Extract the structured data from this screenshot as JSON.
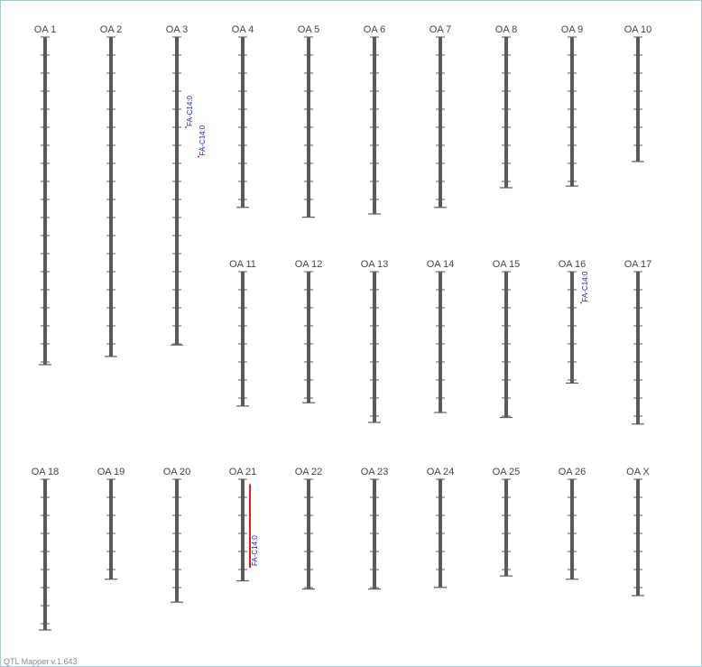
{
  "app": {
    "version_label": "QTL Mapper v.1.643"
  },
  "colors": {
    "chromosome": "#5a5a5a",
    "tick": "#5a5a5a",
    "label": "#444444",
    "qtl_text": "#1a1acc",
    "qtl_bar": "#e02020",
    "border": "#a9c6dc"
  },
  "chromosomes": [
    {
      "name": "OA 1",
      "length": 1.0
    },
    {
      "name": "OA 2",
      "length": 0.975
    },
    {
      "name": "OA 3",
      "length": 0.94
    },
    {
      "name": "OA 4",
      "length": 0.52
    },
    {
      "name": "OA 5",
      "length": 0.55
    },
    {
      "name": "OA 6",
      "length": 0.54
    },
    {
      "name": "OA 7",
      "length": 0.52
    },
    {
      "name": "OA 8",
      "length": 0.46
    },
    {
      "name": "OA 9",
      "length": 0.455
    },
    {
      "name": "OA 10",
      "length": 0.38
    },
    {
      "name": "OA 11",
      "length": 0.41
    },
    {
      "name": "OA 12",
      "length": 0.4
    },
    {
      "name": "OA 13",
      "length": 0.46
    },
    {
      "name": "OA 14",
      "length": 0.43
    },
    {
      "name": "OA 15",
      "length": 0.445
    },
    {
      "name": "OA 16",
      "length": 0.34
    },
    {
      "name": "OA 17",
      "length": 0.465
    },
    {
      "name": "OA 18",
      "length": 0.46
    },
    {
      "name": "OA 19",
      "length": 0.305
    },
    {
      "name": "OA 20",
      "length": 0.375
    },
    {
      "name": "OA 21",
      "length": 0.31
    },
    {
      "name": "OA 22",
      "length": 0.335
    },
    {
      "name": "OA 23",
      "length": 0.335
    },
    {
      "name": "OA 24",
      "length": 0.33
    },
    {
      "name": "OA 25",
      "length": 0.295
    },
    {
      "name": "OA 26",
      "length": 0.305
    },
    {
      "name": "OA X",
      "length": 0.355
    }
  ],
  "qtls": [
    {
      "chromosome": "OA 3",
      "label": "FA-C14:0",
      "position": 0.275,
      "type": "marker"
    },
    {
      "chromosome": "OA 3",
      "label": "FA-C14:0",
      "position": 0.365,
      "type": "marker"
    },
    {
      "chromosome": "OA 16",
      "label": "FA-C14:0",
      "position": 0.095,
      "type": "marker"
    },
    {
      "chromosome": "OA 21",
      "label": "FA-C14:0",
      "start": 0.015,
      "end": 0.27,
      "type": "interval"
    }
  ]
}
